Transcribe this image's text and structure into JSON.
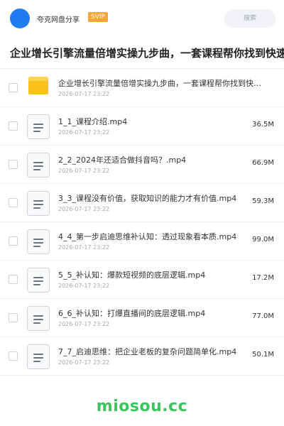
{
  "header": {
    "brand": "夸克网盘分享",
    "badge": "SVIP",
    "search_placeholder": "搜索"
  },
  "page_title": "企业增长引擎流量倍增实操九步曲，一套课程帮你找到快速",
  "items": [
    {
      "type": "folder",
      "name": "企业增长引擎流量倍增实操九步曲，一套课程帮你找到快速…",
      "date": "2026-07-17 23:22",
      "size": ""
    },
    {
      "type": "file",
      "name": "1_1_课程介绍.mp4",
      "date": "2026-07-17 23:22",
      "size": "36.5M"
    },
    {
      "type": "file",
      "name": "2_2_2024年还适合做抖音吗？.mp4",
      "date": "2026-07-17 23:22",
      "size": "66.9M"
    },
    {
      "type": "file",
      "name": "3_3_课程没有价值，获取知识的能力才有价值.mp4",
      "date": "2026-07-17 23:22",
      "size": "59.3M"
    },
    {
      "type": "file",
      "name": "4_4_第一步启迪思维补认知：透过现象看本质.mp4",
      "date": "2026-07-17 23:22",
      "size": "99.0M"
    },
    {
      "type": "file",
      "name": "5_5_补认知：爆款短视频的底层逻辑.mp4",
      "date": "2026-07-17 23:22",
      "size": "17.2M"
    },
    {
      "type": "file",
      "name": "6_6_补认知：打爆直播间的底层逻辑.mp4",
      "date": "2026-07-17 23:22",
      "size": "77.0M"
    },
    {
      "type": "file",
      "name": "7_7_启迪思维：把企业老板的复杂问题简单化.mp4",
      "date": "2026-07-17 23:22",
      "size": "50.1M"
    }
  ],
  "watermark": "miosou.cc",
  "colors": {
    "accent": "#1f7cf3",
    "badge": "#f7a534",
    "folder": "#fbc21b",
    "watermark": "#3bc45d"
  }
}
